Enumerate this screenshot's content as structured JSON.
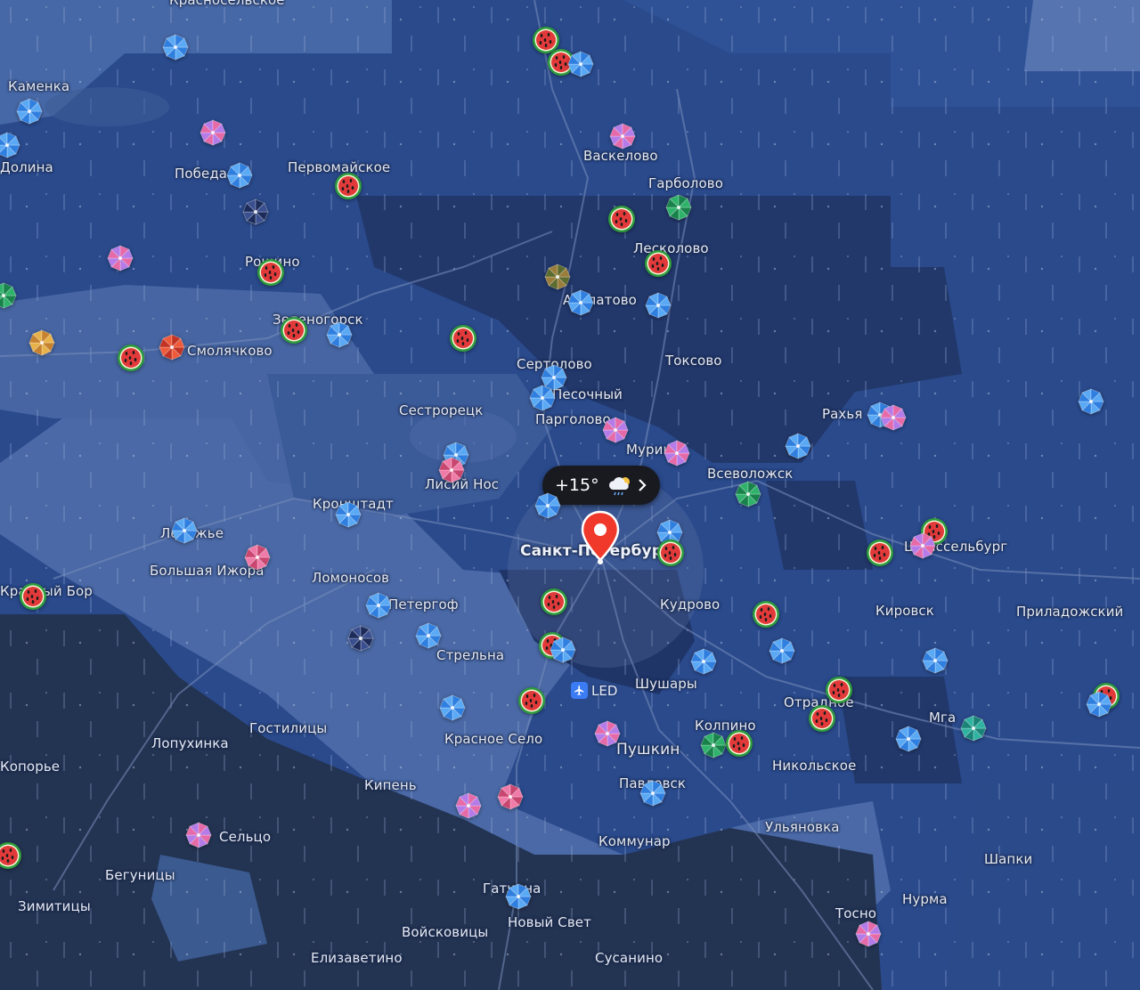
{
  "weather": {
    "temperature": "+15°",
    "condition_icon": "cloud-sun-rain-icon"
  },
  "airport": {
    "code": "LED",
    "icon": "airplane-icon"
  },
  "places": {
    "kamenka": "Каменка",
    "dolina": "Долина",
    "pobeda": "Победа",
    "pervomayskoe": "Первомайское",
    "vaskelovo": "Васкелово",
    "garbolovo": "Гарболово",
    "leskolovo": "Лесколово",
    "roshchino": "Рощино",
    "zelenogorsk": "Зеленогорск",
    "agalatovo": "Агалатово",
    "smolyachkovo": "Смолячково",
    "sertolovo": "Сертолово",
    "toksovo": "Токсово",
    "pesochny": "Песочный",
    "sestroretsk": "Сестрорецк",
    "pargolovo": "Парголово",
    "murino": "Мурино",
    "rakhya": "Рахья",
    "lisiy_nos": "Лисий Нос",
    "vsevolozhsk": "Всеволожск",
    "kronshtadt": "Кронштадт",
    "lebyazhye": "Лебяжье",
    "spb": "Санкт-Петербург",
    "shlisselburg": "Шлиссельбург",
    "bolshaya_izhora": "Большая Ижора",
    "lomonosov": "Ломоносов",
    "krasny_bor": "Красный Бор",
    "petergof": "Петергоф",
    "kudrovo": "Кудрово",
    "kirovsk": "Кировск",
    "priladozhsky": "Приладожский",
    "strelna": "Стрельна",
    "shushary": "Шушары",
    "otradnoe": "Отрадное",
    "gostilitsy": "Гостилицы",
    "lopukhinka": "Лопухинка",
    "krasnoe_selo": "Красное Село",
    "kolpino": "Колпино",
    "mga": "Мга",
    "pushkin": "Пушкин",
    "koporye": "Копорье",
    "kipen": "Кипень",
    "nikolskoe": "Никольское",
    "pavlovsk": "Павловск",
    "seltso": "Сельцо",
    "kommunar": "Коммунар",
    "ulyanovka": "Ульяновка",
    "shapki": "Шапки",
    "begunitsy": "Бегуницы",
    "gatchina": "Гатчина",
    "zimititsy": "Зимитицы",
    "nurma": "Нурма",
    "tosno": "Тосно",
    "voyskovitsy": "Войсковицы",
    "novy_svet": "Новый Свет",
    "elizavetino": "Елизаветино",
    "susanino": "Сусанино",
    "krasnoselskoe": "Красносельское"
  },
  "colors": {
    "water": "#3a5a92",
    "land_dark": "#1f3058",
    "rain_heavy": "#2a4a8c",
    "rain_light": "#4665a2",
    "clear_area": "#23314f",
    "umbrella_blue": "#4a9bf0",
    "watermelon_red": "#e23a3a",
    "pin_red": "#f0382b"
  },
  "marker_types": [
    "umbrella-blue-icon",
    "watermelon-icon",
    "umbrella-purple-icon",
    "umbrella-green-icon",
    "umbrella-dark-icon",
    "umbrella-orange-icon",
    "umbrella-red-icon",
    "umbrella-teal-icon",
    "umbrella-pink-icon",
    "umbrella-olive-icon"
  ]
}
